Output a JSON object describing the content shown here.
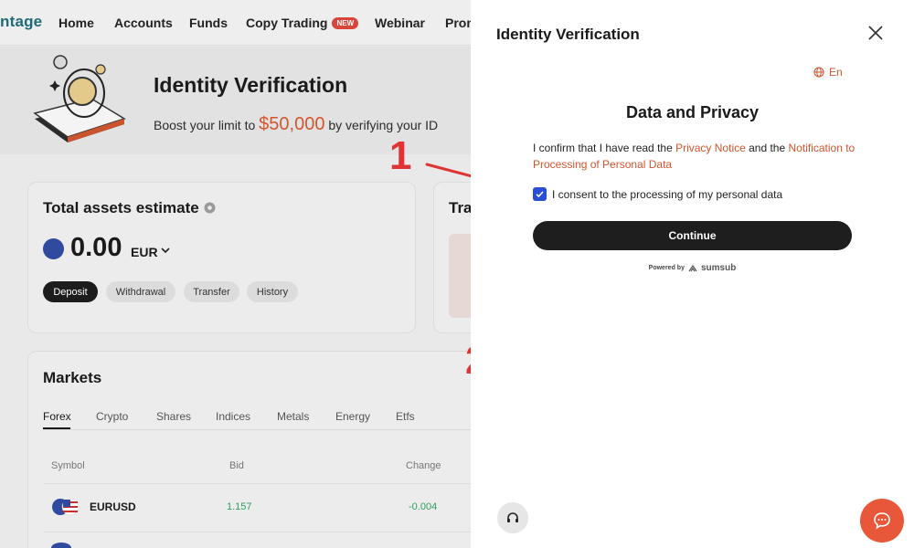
{
  "nav": {
    "logo": "ntage",
    "items": [
      "Home",
      "Accounts",
      "Funds",
      "Copy Trading",
      "Webinar",
      "Prom"
    ],
    "new_badge": "NEW"
  },
  "banner": {
    "title": "Identity Verification",
    "subtitle_prefix": "Boost your limit to ",
    "amount": "$50,000",
    "subtitle_suffix": " by verifying your ID"
  },
  "assets": {
    "title": "Total assets estimate",
    "balance": "0.00",
    "currency": "EUR",
    "actions": [
      "Deposit",
      "Withdrawal",
      "Transfer",
      "History"
    ]
  },
  "transfer_card": {
    "title": "Tra"
  },
  "markets": {
    "title": "Markets",
    "tabs": [
      "Forex",
      "Crypto",
      "Shares",
      "Indices",
      "Metals",
      "Energy",
      "Etfs"
    ],
    "columns": [
      "Symbol",
      "Bid",
      "Change"
    ],
    "rows": [
      {
        "symbol": "EURUSD",
        "bid": "1.157",
        "change": "-0.004"
      }
    ]
  },
  "annotations": [
    "1",
    "2"
  ],
  "panel": {
    "title": "Identity Verification",
    "language": "En",
    "section_title": "Data and Privacy",
    "text_1": "I confirm that I have read the ",
    "privacy_link": "Privacy Notice",
    "text_2": " and the ",
    "processing_link": "Notification to Processing of Personal Data",
    "checkbox_label": "I consent to the processing of my personal data",
    "checkbox_checked": true,
    "continue_label": "Continue",
    "powered_by": "Powered by",
    "provider": "sumsub"
  },
  "colors": {
    "accent": "#d2552e",
    "checkbox": "#2a4fd4",
    "button": "#1e1e1e",
    "chat_fab": "#e8573a",
    "annotation": "#e03333"
  }
}
